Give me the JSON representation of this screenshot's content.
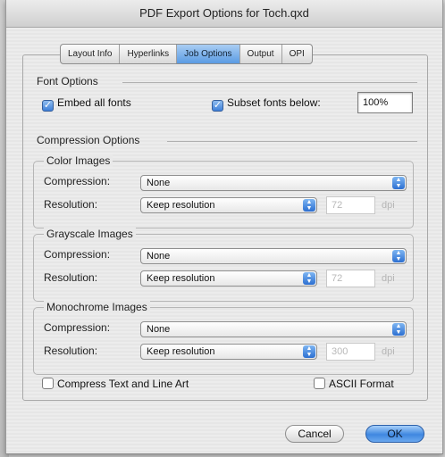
{
  "window": {
    "title": "PDF Export Options for Toch.qxd"
  },
  "tabs": [
    {
      "label": "Layout Info",
      "active": false
    },
    {
      "label": "Hyperlinks",
      "active": false
    },
    {
      "label": "Job Options",
      "active": true
    },
    {
      "label": "Output",
      "active": false
    },
    {
      "label": "OPI",
      "active": false
    }
  ],
  "font_options": {
    "title": "Font Options",
    "embed_all": {
      "label": "Embed all fonts",
      "checked": true
    },
    "subset": {
      "label": "Subset fonts below:",
      "checked": true,
      "value": "100%"
    }
  },
  "compression_options": {
    "title": "Compression Options",
    "compression_label": "Compression:",
    "resolution_label": "Resolution:",
    "unit": "dpi",
    "color": {
      "title": "Color Images",
      "compression": "None",
      "resolution": "Keep resolution",
      "dpi": "72"
    },
    "grayscale": {
      "title": "Grayscale Images",
      "compression": "None",
      "resolution": "Keep resolution",
      "dpi": "72"
    },
    "monochrome": {
      "title": "Monochrome Images",
      "compression": "None",
      "resolution": "Keep resolution",
      "dpi": "300"
    }
  },
  "compress_text": {
    "label": "Compress Text and Line Art",
    "checked": false
  },
  "ascii_format": {
    "label": "ASCII Format",
    "checked": false
  },
  "buttons": {
    "cancel": "Cancel",
    "ok": "OK"
  },
  "colors": {
    "accent": "#3f87e0",
    "tab_active": "#5a9be3"
  }
}
